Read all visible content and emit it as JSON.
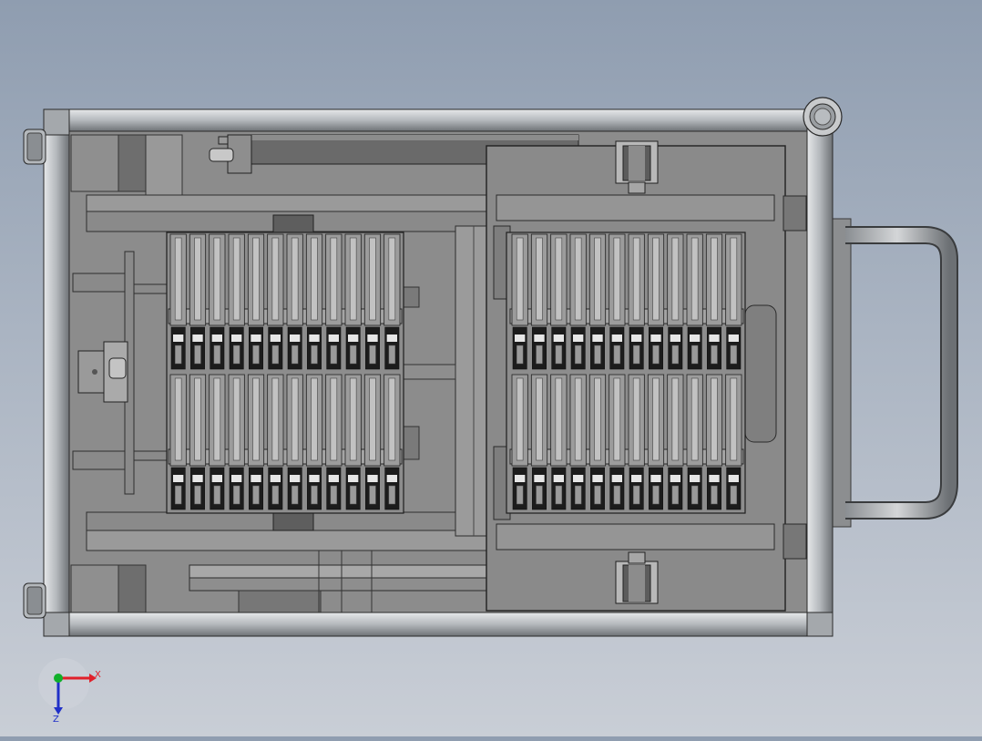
{
  "viewport": {
    "background_top": "#8f9db0",
    "background_bottom": "#c9ced6",
    "model": {
      "frame_color": "#b9bcc0",
      "plate_color": "#8c8c8c",
      "dark_color": "#5c5c5c",
      "left_tray": {
        "columns": 12,
        "rows": 2
      },
      "right_tray": {
        "columns": 12,
        "rows": 2
      }
    }
  },
  "triad": {
    "x_label": "X",
    "z_label": "Z",
    "x_color": "#e0202a",
    "y_color": "#10b02a",
    "z_color": "#2030c8"
  }
}
